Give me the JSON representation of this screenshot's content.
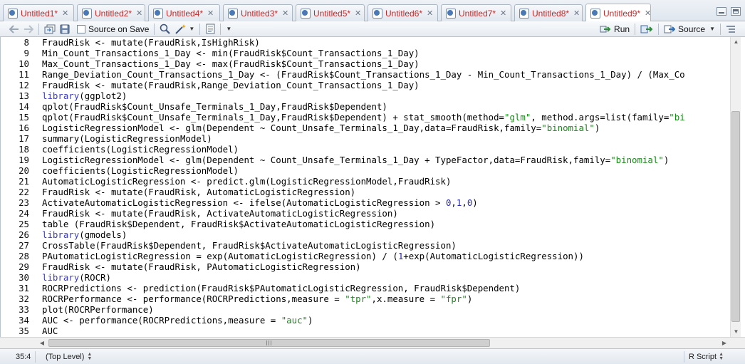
{
  "tabs": [
    {
      "label": "Untitled1*",
      "left": 0
    },
    {
      "label": "Untitled2*",
      "left": 0
    },
    {
      "label": "Untitled4*",
      "left": 0
    },
    {
      "label": "Untitled3*",
      "left": 0
    },
    {
      "label": "Untitled5*",
      "left": 0
    },
    {
      "label": "Untitled6*",
      "left": 0
    },
    {
      "label": "Untitled7*",
      "left": 0
    },
    {
      "label": "Untitled8*",
      "left": 0
    },
    {
      "label": "Untitled9*",
      "left": 0,
      "active": true
    }
  ],
  "toolbar": {
    "source_on_save_label": "Source on Save",
    "run_label": "Run",
    "source_label": "Source"
  },
  "editor": {
    "first_line_number": 8,
    "lines": [
      [
        [
          "FraudRisk <- mutate(FraudRisk,IsHighRisk)",
          ""
        ]
      ],
      [
        [
          "Min_Count_Transactions_1_Day <- min(FraudRisk$Count_Transactions_1_Day)",
          ""
        ]
      ],
      [
        [
          "Max_Count_Transactions_1_Day <- max(FraudRisk$Count_Transactions_1_Day)",
          ""
        ]
      ],
      [
        [
          "Range_Deviation_Count_Transactions_1_Day <- (FraudRisk$Count_Transactions_1_Day - Min_Count_Transactions_1_Day) / (Max_Co",
          ""
        ]
      ],
      [
        [
          "FraudRisk <- mutate(FraudRisk,Range_Deviation_Count_Transactions_1_Day)",
          ""
        ]
      ],
      [
        [
          "library",
          "kw"
        ],
        [
          "(ggplot2)",
          ""
        ]
      ],
      [
        [
          "qplot(FraudRisk$Count_Unsafe_Terminals_1_Day,FraudRisk$Dependent)",
          ""
        ]
      ],
      [
        [
          "qplot(FraudRisk$Count_Unsafe_Terminals_1_Day,FraudRisk$Dependent) + stat_smooth(method=",
          ""
        ],
        [
          "\"glm\"",
          "str"
        ],
        [
          ", method.args=list(family=",
          ""
        ],
        [
          "\"bi",
          "str"
        ]
      ],
      [
        [
          "LogisticRegressionModel <- glm(Dependent ~ Count_Unsafe_Terminals_1_Day,data=FraudRisk,family=",
          ""
        ],
        [
          "\"binomial\"",
          "str"
        ],
        [
          ")",
          ""
        ]
      ],
      [
        [
          "summary(LogisticRegressionModel)",
          ""
        ]
      ],
      [
        [
          "coefficients(LogisticRegressionModel)",
          ""
        ]
      ],
      [
        [
          "LogisticRegressionModel <- glm(Dependent ~ Count_Unsafe_Terminals_1_Day + TypeFactor,data=FraudRisk,family=",
          ""
        ],
        [
          "\"binomial\"",
          "str"
        ],
        [
          ")",
          ""
        ]
      ],
      [
        [
          "coefficients(LogisticRegressionModel)",
          ""
        ]
      ],
      [
        [
          "AutomaticLogisticRegression <- predict.glm(LogisticRegressionModel,FraudRisk)",
          ""
        ]
      ],
      [
        [
          "FraudRisk <- mutate(FraudRisk, AutomaticLogisticRegression)",
          ""
        ]
      ],
      [
        [
          "ActivateAutomaticLogisticRegression <- ifelse(AutomaticLogisticRegression > ",
          ""
        ],
        [
          "0",
          "num"
        ],
        [
          ",",
          ""
        ],
        [
          "1",
          "num"
        ],
        [
          ",",
          ""
        ],
        [
          "0",
          "num"
        ],
        [
          ")",
          ""
        ]
      ],
      [
        [
          "FraudRisk <- mutate(FraudRisk, ActivateAutomaticLogisticRegression)",
          ""
        ]
      ],
      [
        [
          "table (FraudRisk$Dependent, FraudRisk$ActivateAutomaticLogisticRegression)",
          ""
        ]
      ],
      [
        [
          "library",
          "kw"
        ],
        [
          "(gmodels)",
          ""
        ]
      ],
      [
        [
          "CrossTable(FraudRisk$Dependent, FraudRisk$ActivateAutomaticLogisticRegression)",
          ""
        ]
      ],
      [
        [
          "PAutomaticLogisticRegression = exp(AutomaticLogisticRegression) / (",
          ""
        ],
        [
          "1",
          "num"
        ],
        [
          "+exp(AutomaticLogisticRegression))",
          ""
        ]
      ],
      [
        [
          "FraudRisk <- mutate(FraudRisk, PAutomaticLogisticRegression)",
          ""
        ]
      ],
      [
        [
          "library",
          "kw"
        ],
        [
          "(ROCR)",
          ""
        ]
      ],
      [
        [
          "ROCRPredictions <- prediction(FraudRisk$PAutomaticLogisticRegression, FraudRisk$Dependent)",
          ""
        ]
      ],
      [
        [
          "ROCRPerformance <- performance(ROCRPredictions,measure = ",
          ""
        ],
        [
          "\"tpr\"",
          "str"
        ],
        [
          ",x.measure = ",
          ""
        ],
        [
          "\"fpr\"",
          "str"
        ],
        [
          ")",
          ""
        ]
      ],
      [
        [
          "plot(ROCRPerformance)",
          ""
        ]
      ],
      [
        [
          "AUC <- performance(ROCRPredictions,measure = ",
          ""
        ],
        [
          "\"auc\"",
          "str"
        ],
        [
          ")",
          ""
        ]
      ],
      [
        [
          "AUC",
          ""
        ]
      ]
    ]
  },
  "status": {
    "cursor_position": "35:4",
    "scope": "(Top Level)",
    "language": "R Script"
  },
  "colors": {
    "tab_label": "#c22b2b",
    "keyword": "#3a3ac9",
    "string": "#1a8a1a",
    "number": "#2929b8"
  }
}
